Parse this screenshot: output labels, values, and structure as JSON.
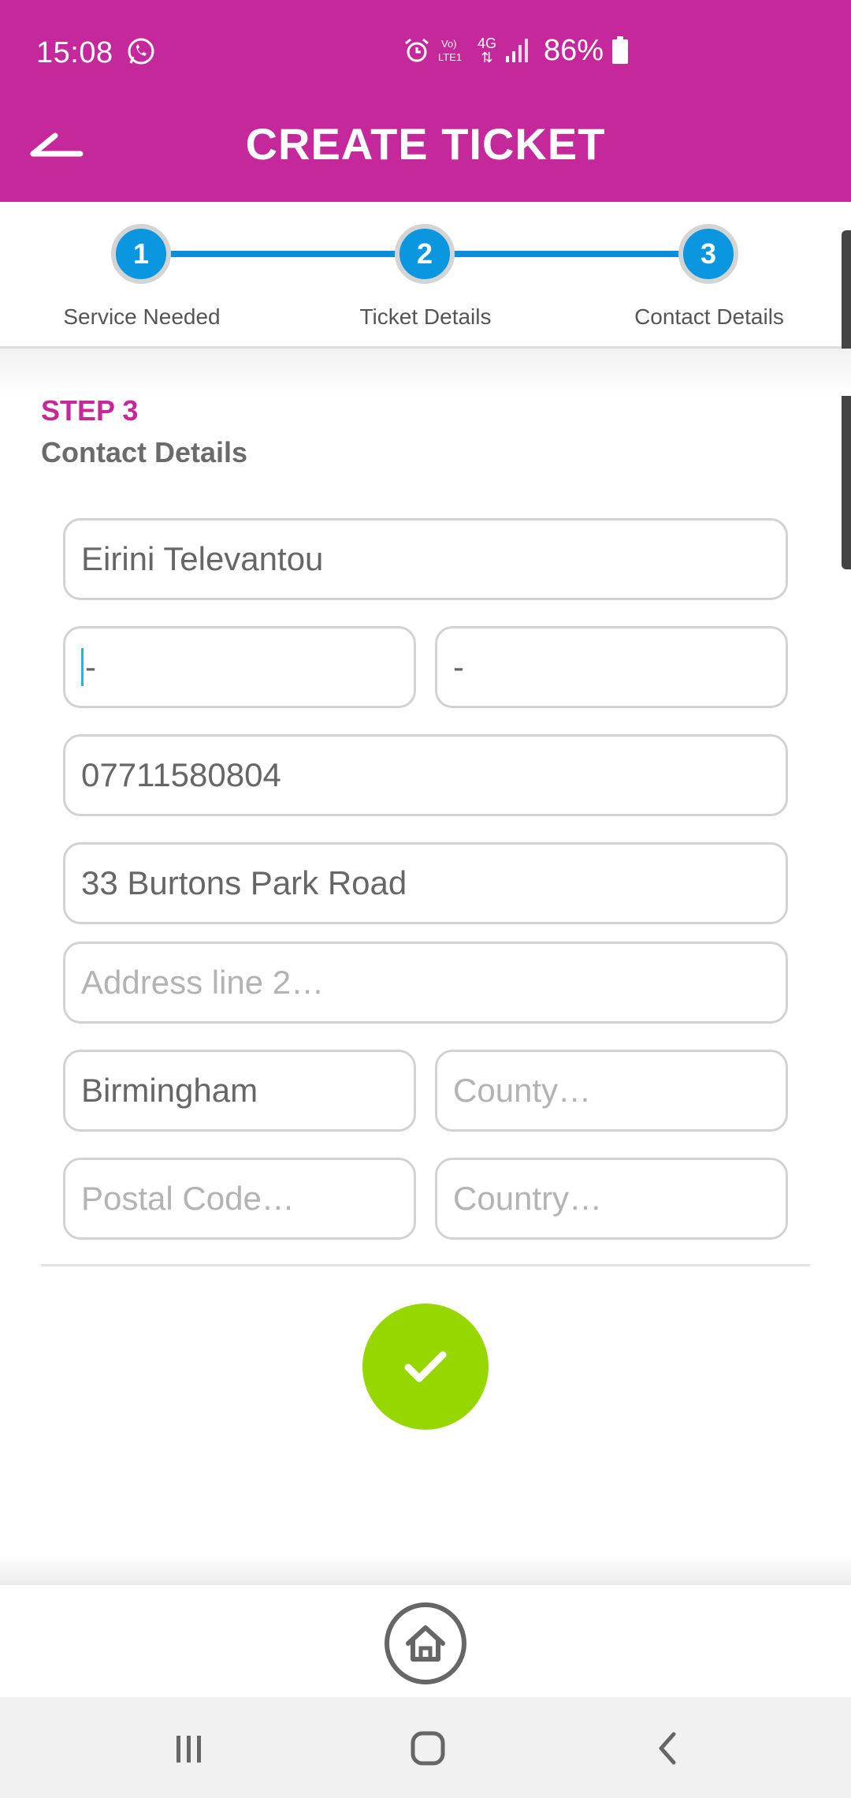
{
  "status_bar": {
    "time": "15:08",
    "network": "4G",
    "battery": "86%"
  },
  "app_bar": {
    "title": "CREATE TICKET"
  },
  "stepper": {
    "steps": [
      {
        "number": "1",
        "label": "Service Needed"
      },
      {
        "number": "2",
        "label": "Ticket Details"
      },
      {
        "number": "3",
        "label": "Contact Details"
      }
    ],
    "active_step": 3
  },
  "section": {
    "kicker": "STEP 3",
    "title": "Contact Details"
  },
  "form": {
    "name": {
      "value": "Eirini Televantou"
    },
    "field_a": {
      "value": "-"
    },
    "field_b": {
      "value": "-"
    },
    "phone": {
      "value": "07711580804"
    },
    "address1": {
      "value": "33 Burtons Park Road"
    },
    "address2": {
      "placeholder": "Address line 2…"
    },
    "city": {
      "value": "Birmingham"
    },
    "county": {
      "placeholder": "County…"
    },
    "postal_code": {
      "placeholder": "Postal Code…"
    },
    "country": {
      "placeholder": "Country…"
    }
  },
  "colors": {
    "brand": "#c4289b",
    "step_blue": "#0b96e0",
    "submit_green": "#97d700"
  },
  "icons": {
    "back": "back-arrow-icon",
    "submit": "checkmark-icon",
    "home": "home-icon",
    "nav_recents": "recents-icon",
    "nav_home": "nav-home-icon",
    "nav_back": "nav-back-icon"
  }
}
